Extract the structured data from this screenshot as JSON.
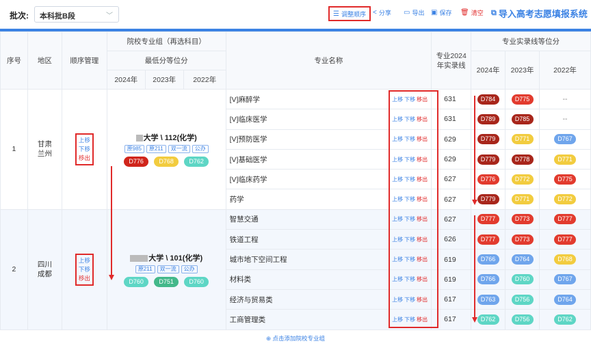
{
  "toolbar": {
    "batch_label": "批次:",
    "batch_value": "本科批B段",
    "adjust_label": "调整顺序",
    "share_label": "分享",
    "export_label": "导出",
    "save_label": "保存",
    "clear_label": "清空",
    "import_label": "导入高考志愿填报系统"
  },
  "headers": {
    "seq": "序号",
    "region": "地区",
    "order_mgmt": "顺序管理",
    "group": "院校专业组（再选科目）",
    "min_rank": "最低分等位分",
    "y2024": "2024年",
    "y2023": "2023年",
    "y2022": "2022年",
    "major": "专业名称",
    "score_line": "专业2024年实录线",
    "rank_group": "专业实录线等位分"
  },
  "ops": {
    "up": "上移",
    "down": "下移",
    "out": "移出"
  },
  "groups": [
    {
      "seq": "1",
      "region": "甘肃兰州",
      "college": "大学 \\ 112(化学)",
      "tags": [
        "原985",
        "原211",
        "双一流",
        "公办"
      ],
      "ranks": [
        "D776",
        "D768",
        "D762"
      ],
      "rank_colors": [
        "#d0251b",
        "#f2cc3f",
        "#5ed6c5"
      ],
      "majors": [
        {
          "name": "[V]麻醉学",
          "score": "631",
          "ranks": [
            "D784",
            "D775",
            "--"
          ]
        },
        {
          "name": "[V]临床医学",
          "score": "631",
          "ranks": [
            "D789",
            "D785",
            "--"
          ]
        },
        {
          "name": "[V]预防医学",
          "score": "629",
          "ranks": [
            "D779",
            "D771",
            "D767"
          ]
        },
        {
          "name": "[V]基础医学",
          "score": "629",
          "ranks": [
            "D779",
            "D778",
            "D771"
          ]
        },
        {
          "name": "[V]临床药学",
          "score": "627",
          "ranks": [
            "D776",
            "D772",
            "D775"
          ]
        },
        {
          "name": "药学",
          "score": "627",
          "ranks": [
            "D779",
            "D771",
            "D772"
          ]
        }
      ]
    },
    {
      "seq": "2",
      "region": "四川成都",
      "college": "大学 \\ 101(化学)",
      "tags": [
        "原211",
        "双一流",
        "公办"
      ],
      "ranks": [
        "D760",
        "D751",
        "D760"
      ],
      "rank_colors": [
        "#5ed6c5",
        "#43b88a",
        "#5ed6c5"
      ],
      "majors": [
        {
          "name": "智慧交通",
          "score": "627",
          "ranks": [
            "D777",
            "D773",
            "D777"
          ]
        },
        {
          "name": "铁道工程",
          "score": "626",
          "ranks": [
            "D777",
            "D773",
            "D777"
          ]
        },
        {
          "name": "城市地下空间工程",
          "score": "619",
          "ranks": [
            "D766",
            "D764",
            "D768"
          ]
        },
        {
          "name": "材料类",
          "score": "619",
          "ranks": [
            "D766",
            "D760",
            "D767"
          ]
        },
        {
          "name": "经济与贸易类",
          "score": "617",
          "ranks": [
            "D763",
            "D756",
            "D764"
          ]
        },
        {
          "name": "工商管理类",
          "score": "617",
          "ranks": [
            "D762",
            "D756",
            "D762"
          ]
        }
      ]
    }
  ],
  "major_rank_colors": [
    [
      "#a8261b",
      "#e23b2e",
      "none"
    ],
    [
      "#a8261b",
      "#a8261b",
      "none"
    ],
    [
      "#a8261b",
      "#f2cc3f",
      "#6fa5ec"
    ],
    [
      "#a8261b",
      "#a8261b",
      "#f2cc3f"
    ],
    [
      "#e23b2e",
      "#f2cc3f",
      "#e23b2e"
    ],
    [
      "#a8261b",
      "#f2cc3f",
      "#f2cc3f"
    ],
    [
      "#e23b2e",
      "#e23b2e",
      "#e23b2e"
    ],
    [
      "#e23b2e",
      "#e23b2e",
      "#e23b2e"
    ],
    [
      "#6fa5ec",
      "#6fa5ec",
      "#f2cc3f"
    ],
    [
      "#6fa5ec",
      "#5ed6c5",
      "#6fa5ec"
    ],
    [
      "#6fa5ec",
      "#5ed6c5",
      "#6fa5ec"
    ],
    [
      "#5ed6c5",
      "#5ed6c5",
      "#5ed6c5"
    ]
  ],
  "add_group": "⊕ 点击添加院校专业组"
}
